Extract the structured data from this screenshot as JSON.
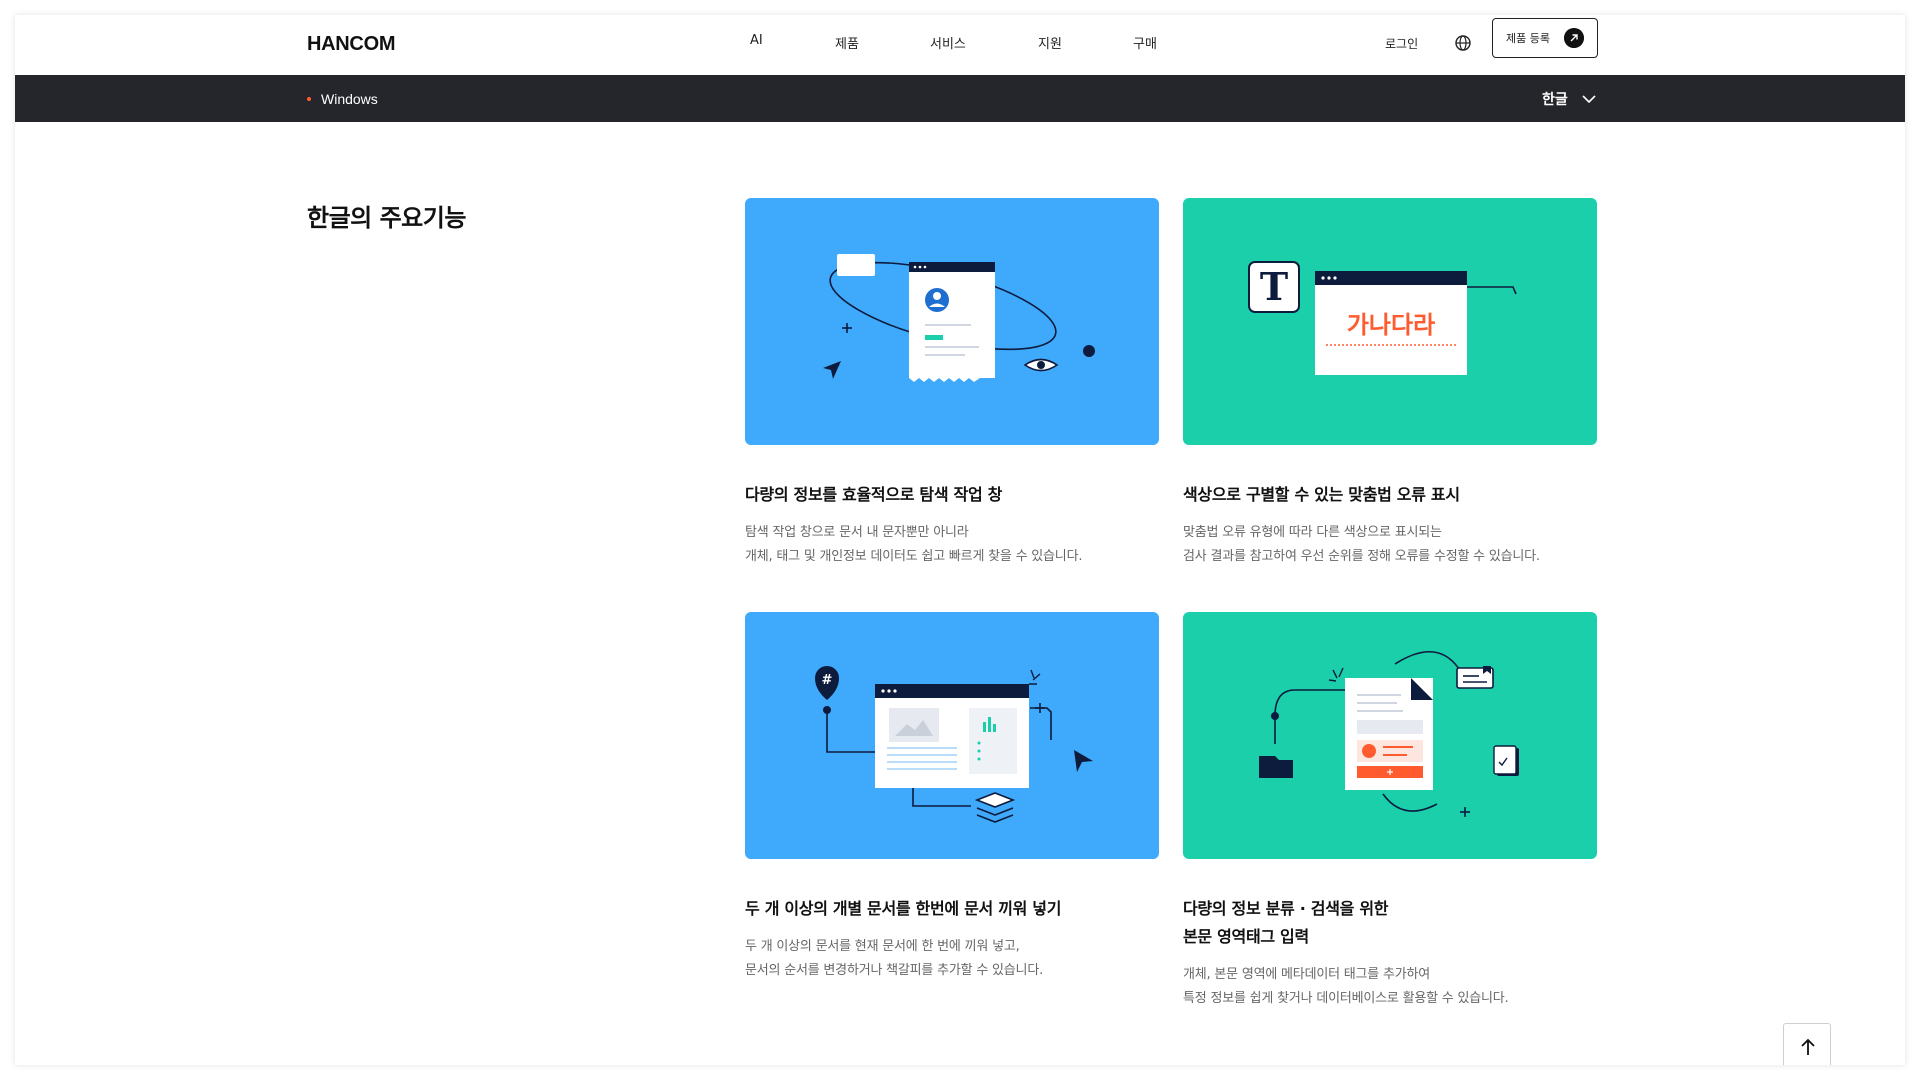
{
  "header": {
    "logo": "HANCOM",
    "nav": [
      "AI",
      "제품",
      "서비스",
      "지원",
      "구매"
    ],
    "login": "로그인",
    "register_button": "제품 등록"
  },
  "subbar": {
    "platform": "Windows",
    "product_select": "한글"
  },
  "main": {
    "section_title": "한글의 주요기능",
    "cards": [
      {
        "title": "다량의 정보를 효율적으로 탐색 작업 창",
        "desc_line1": "탐색 작업 창으로 문서 내 문자뿐만 아니라",
        "desc_line2": "개체, 태그 및 개인정보 데이터도 쉽고 빠르게 찾을 수 있습니다."
      },
      {
        "title": "색상으로 구별할 수 있는 맞춤법 오류 표시",
        "desc_line1": "맞춤법 오류 유형에 따라 다른 색상으로 표시되는",
        "desc_line2": "검사 결과를 참고하여 우선 순위를 정해 오류를 수정할 수 있습니다.",
        "illus_text": "가나다라",
        "illus_letter": "T"
      },
      {
        "title": "두 개 이상의 개별 문서를 한번에 문서 끼워 넣기",
        "desc_line1": "두 개 이상의 문서를 현재 문서에 한 번에 끼워 넣고,",
        "desc_line2": "문서의 순서를 변경하거나 책갈피를 추가할 수 있습니다.",
        "illus_tag": "#"
      },
      {
        "title_line1": "다량의 정보 분류 · 검색을 위한",
        "title_line2": "본문 영역태그 입력",
        "desc_line1": "개체, 본문 영역에 메타데이터 태그를 추가하여",
        "desc_line2": "특정 정보를 쉽게 찾거나 데이터베이스로 활용할 수 있습니다."
      }
    ]
  },
  "colors": {
    "blue_card": "#3fa9fc",
    "green_card": "#1bcfab",
    "accent": "#ff5b2e",
    "navy": "#0d1b3d",
    "subbar": "#25262b"
  },
  "icons": [
    "globe-icon",
    "arrow-up-right-icon",
    "chevron-down-icon",
    "arrow-up-icon"
  ]
}
